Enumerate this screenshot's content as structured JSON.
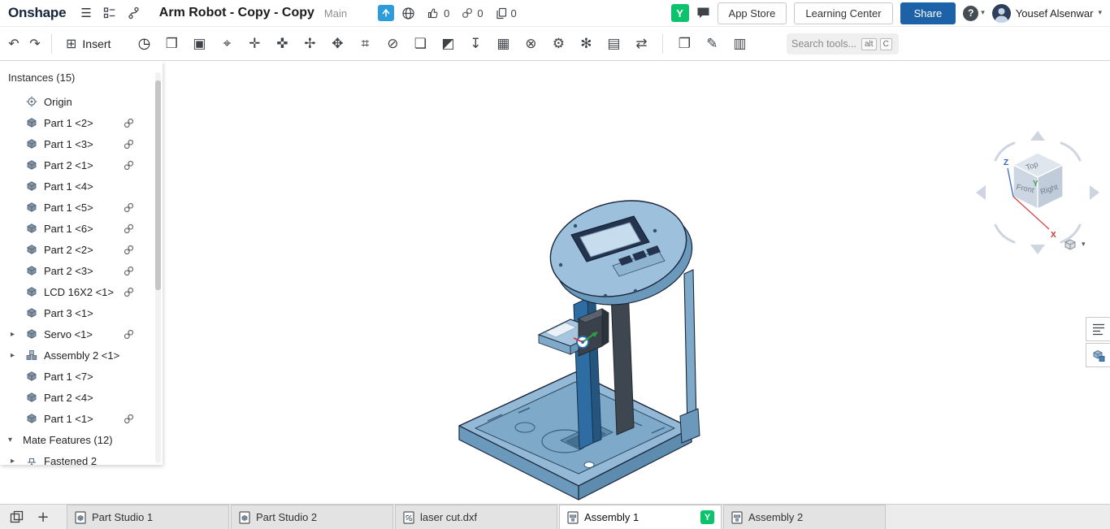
{
  "icons": {
    "hamburger": "☰",
    "caret_down": "▾",
    "caret_collapsed": "▸",
    "caret_expanded": "▾",
    "plus": "+",
    "undo": "↶",
    "redo": "↷",
    "insert": "⊞",
    "help": "?"
  },
  "header": {
    "logo_text": "Onshape",
    "title": "Arm Robot - Copy - Copy",
    "workspace": "Main",
    "like_count": "0",
    "link_count": "0",
    "copy_count": "0",
    "collaborator_initial": "Y",
    "app_store_label": "App Store",
    "learning_center_label": "Learning Center",
    "share_label": "Share",
    "user_name": "Yousef Alsenwar"
  },
  "toolbar": {
    "insert_label": "Insert",
    "search": {
      "placeholder": "Search tools...",
      "shortcut_alt": "alt",
      "shortcut_key": "C"
    },
    "icons": [
      {
        "name": "mate-icon",
        "glyph": "◷"
      },
      {
        "name": "group-icon",
        "glyph": "❒"
      },
      {
        "name": "replicate-icon",
        "glyph": "▣"
      },
      {
        "name": "mate-connector-icon",
        "glyph": "⌖"
      },
      {
        "name": "move-icon",
        "glyph": "✛"
      },
      {
        "name": "rotate-icon",
        "glyph": "✜"
      },
      {
        "name": "snap-mode-icon",
        "glyph": "✢"
      },
      {
        "name": "explode-icon",
        "glyph": "✥"
      },
      {
        "name": "measure-icon",
        "glyph": "⌗"
      },
      {
        "name": "section-view-icon",
        "glyph": "⊘"
      },
      {
        "name": "frame-icon",
        "glyph": "❏"
      },
      {
        "name": "appearance-icon",
        "glyph": "◩"
      },
      {
        "name": "export-icon",
        "glyph": "↧"
      },
      {
        "name": "bom-icon",
        "glyph": "▦"
      },
      {
        "name": "interference-icon",
        "glyph": "⊗"
      },
      {
        "name": "gear-relation-icon",
        "glyph": "⚙"
      },
      {
        "name": "motion-study-icon",
        "glyph": "✻"
      },
      {
        "name": "rack-pinion-icon",
        "glyph": "▤"
      },
      {
        "name": "swap-instance-icon",
        "glyph": "⇄"
      },
      {
        "name": "drawing-icon",
        "glyph": "❐"
      },
      {
        "name": "markup-icon",
        "glyph": "✎"
      },
      {
        "name": "sheet-icon",
        "glyph": "▥"
      }
    ]
  },
  "instances_panel": {
    "header": "Instances (15)",
    "items": [
      {
        "label": "Origin"
      },
      {
        "label": "Part 1 <2>"
      },
      {
        "label": "Part 1 <3>"
      },
      {
        "label": "Part 2 <1>"
      },
      {
        "label": "Part 1 <4>"
      },
      {
        "label": "Part 1 <5>"
      },
      {
        "label": "Part 1 <6>"
      },
      {
        "label": "Part 2 <2>"
      },
      {
        "label": "Part 2 <3>"
      },
      {
        "label": "LCD 16X2 <1>"
      },
      {
        "label": "Part 3 <1>"
      },
      {
        "label": "Servo <1>"
      },
      {
        "label": "Assembly 2 <1>"
      },
      {
        "label": "Part 1 <7>"
      },
      {
        "label": "Part 2 <4>"
      },
      {
        "label": "Part 1 <1>"
      }
    ],
    "mate_features_header": "Mate Features (12)",
    "fastened_label": "Fastened 2"
  },
  "viewport": {
    "view_cube": {
      "top": "Top",
      "front": "Front",
      "right": "Right",
      "axis_x": "X",
      "axis_y": "Y",
      "axis_z": "Z"
    }
  },
  "footer": {
    "tabs": [
      {
        "label": "Part Studio 1",
        "type": "part-studio"
      },
      {
        "label": "Part Studio 2",
        "type": "part-studio"
      },
      {
        "label": "laser cut.dxf",
        "type": "dxf"
      },
      {
        "label": "Assembly 1",
        "type": "assembly",
        "active": true,
        "badge": "Y"
      },
      {
        "label": "Assembly 2",
        "type": "assembly"
      }
    ]
  },
  "colors": {
    "accent_blue": "#1d62a8",
    "collab_green": "#0cc36d",
    "model_light": "#9dc1dc",
    "model_mid": "#7fa9c9",
    "model_dark": "#2e6ca4"
  }
}
